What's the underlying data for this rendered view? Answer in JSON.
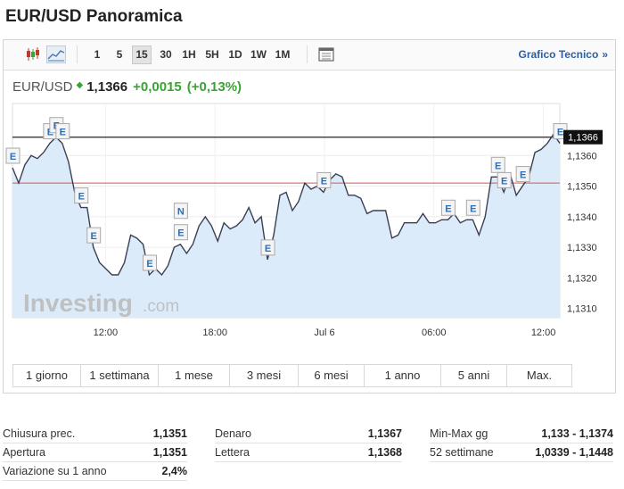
{
  "title": "EUR/USD Panoramica",
  "toolbar": {
    "intervals": [
      "1",
      "5",
      "15",
      "30",
      "1H",
      "5H",
      "1D",
      "1W",
      "1M"
    ],
    "active_interval": "15",
    "technical_link": "Grafico Tecnico",
    "technical_arrow": "»"
  },
  "quote": {
    "symbol": "EUR/USD",
    "arrow": "◆",
    "price": "1,1366",
    "change": "+0,0015",
    "change_pct": "(+0,13%)"
  },
  "chart_data": {
    "type": "line",
    "y_ticks": [
      "1,1360",
      "1,1350",
      "1,1340",
      "1,1330",
      "1,1320",
      "1,1310"
    ],
    "ylim": [
      1.1307,
      1.1377
    ],
    "x_tick_labels": [
      "12:00",
      "18:00",
      "Jul 6",
      "06:00",
      "12:00"
    ],
    "last_price_label": "1,1366",
    "last_price": 1.1366,
    "prev_close": 1.1351,
    "watermark": "Investing",
    "watermark_suffix": ".com",
    "grid": true,
    "values": [
      1.1356,
      1.1351,
      1.1357,
      1.136,
      1.1359,
      1.1361,
      1.1364,
      1.1366,
      1.1364,
      1.1358,
      1.1348,
      1.1343,
      1.1343,
      1.133,
      1.1325,
      1.1323,
      1.1321,
      1.1321,
      1.1325,
      1.1334,
      1.1333,
      1.1331,
      1.1321,
      1.1323,
      1.1321,
      1.1324,
      1.133,
      1.1331,
      1.1328,
      1.1331,
      1.1337,
      1.134,
      1.1337,
      1.1332,
      1.1338,
      1.1336,
      1.1337,
      1.1339,
      1.1343,
      1.1338,
      1.134,
      1.1326,
      1.1334,
      1.1347,
      1.1348,
      1.1342,
      1.1345,
      1.1351,
      1.1349,
      1.135,
      1.1348,
      1.1352,
      1.1354,
      1.1353,
      1.1347,
      1.1347,
      1.1346,
      1.1341,
      1.1342,
      1.1342,
      1.1342,
      1.1333,
      1.1334,
      1.1338,
      1.1338,
      1.1338,
      1.1341,
      1.1338,
      1.1338,
      1.1339,
      1.1339,
      1.1341,
      1.1338,
      1.1339,
      1.1339,
      1.1334,
      1.134,
      1.1353,
      1.1353,
      1.1348,
      1.1354,
      1.1347,
      1.135,
      1.1353,
      1.1361,
      1.1362,
      1.1364,
      1.1367,
      1.1364
    ],
    "events": [
      {
        "label": "E",
        "i": 0
      },
      {
        "label": "E",
        "i": 6
      },
      {
        "label": "E",
        "i": 7
      },
      {
        "label": "E",
        "i": 8
      },
      {
        "label": "E",
        "i": 11
      },
      {
        "label": "E",
        "i": 13
      },
      {
        "label": "E",
        "i": 22
      },
      {
        "label": "N",
        "i": 27
      },
      {
        "label": "E",
        "i": 27
      },
      {
        "label": "E",
        "i": 41
      },
      {
        "label": "E",
        "i": 50
      },
      {
        "label": "E",
        "i": 70
      },
      {
        "label": "E",
        "i": 74
      },
      {
        "label": "E",
        "i": 78
      },
      {
        "label": "E",
        "i": 79
      },
      {
        "label": "E",
        "i": 82
      },
      {
        "label": "E",
        "i": 88
      }
    ]
  },
  "ranges": [
    "1 giorno",
    "1 settimana",
    "1 mese",
    "3 mesi",
    "6 mesi",
    "1 anno",
    "5 anni",
    "Max."
  ],
  "stats": {
    "col1": [
      {
        "label": "Chiusura prec.",
        "value": "1,1351"
      },
      {
        "label": "Apertura",
        "value": "1,1351"
      },
      {
        "label": "Variazione su 1 anno",
        "value": "2,4%"
      }
    ],
    "col2": [
      {
        "label": "Denaro",
        "value": "1,1367"
      },
      {
        "label": "Lettera",
        "value": "1,1368"
      }
    ],
    "col3": [
      {
        "label": "Min-Max gg",
        "value": "1,133 - 1,1374"
      },
      {
        "label": "52 settimane",
        "value": "1,0339 - 1,1448"
      }
    ]
  },
  "colors": {
    "line": "#3a3f55",
    "fill": "#dcebfa",
    "prev_close_line": "#d9534f",
    "last_line": "#222222",
    "positive": "#3aa335",
    "link": "#2c5ea6"
  }
}
